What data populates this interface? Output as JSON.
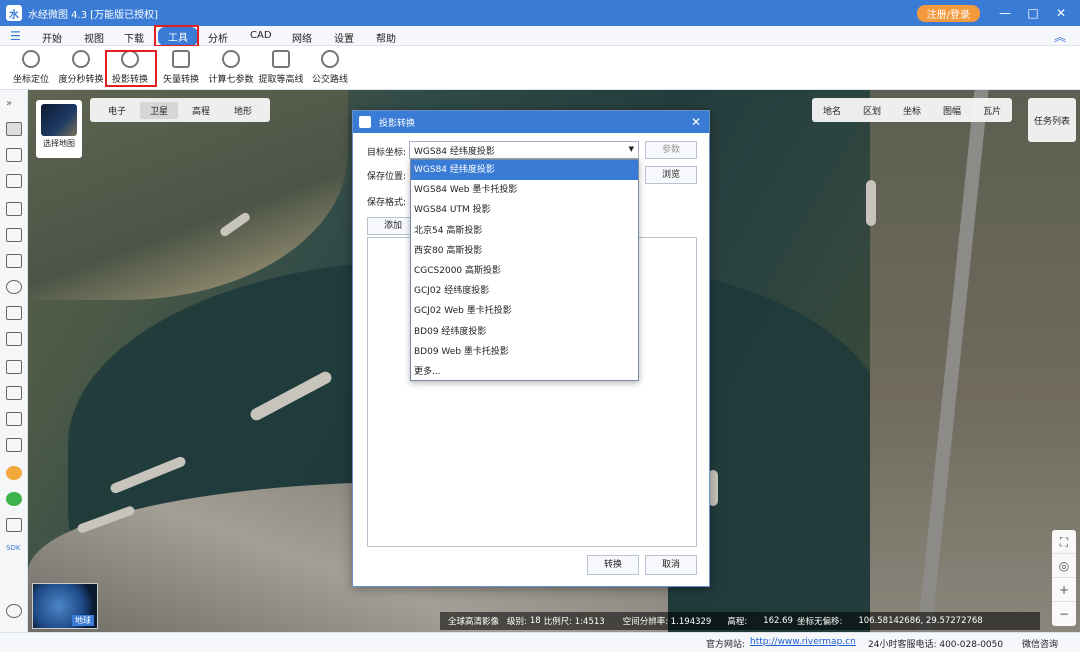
{
  "window": {
    "title": "水经微图 4.3 [万能版已授权]",
    "register_label": "注册/登录",
    "minimize": "—",
    "maximize": "□",
    "close": "✕"
  },
  "menu": {
    "items": [
      "开始",
      "视图",
      "下载",
      "工具",
      "分析",
      "CAD",
      "网络",
      "设置",
      "帮助"
    ],
    "active": "工具",
    "hamburger": "☰",
    "collapse": "︽"
  },
  "toolbar": {
    "items": [
      "坐标定位",
      "度分秒转换",
      "投影转换",
      "矢量转换",
      "计算七参数",
      "提取等高线",
      "公交路线"
    ]
  },
  "map": {
    "tabs": [
      "电子",
      "卫星",
      "高程",
      "地形"
    ],
    "active_tab": "卫星",
    "select_map_label": "选择地图",
    "right_tools": [
      "地名",
      "区划",
      "坐标",
      "图幅",
      "瓦片"
    ],
    "task_list": "任务列表",
    "globe_label": "地球",
    "info": {
      "source": "全球高清影像",
      "level": "级别:",
      "level_value": "18",
      "scale": "比例尺: 1:4513",
      "resolution": "空间分辨率: 1.194329",
      "elevation": "高程:",
      "elevation_value": "162.69",
      "offset": "坐标无偏移:",
      "coords": "106.58142686, 29.57272768"
    },
    "zoom": [
      "⛶",
      "◎",
      "+",
      "−"
    ]
  },
  "status": {
    "website_label": "官方网站:",
    "website": "http://www.rivermap.cn",
    "hotline": "24小时客服电话: 400-028-0050",
    "wechat": "微信咨询"
  },
  "dialog": {
    "title": "投影转换",
    "close": "✕",
    "target_label": "目标坐标:",
    "target_value": "WGS84 经纬度投影",
    "params_button": "参数",
    "save_location_label": "保存位置:",
    "browse_button": "浏览",
    "save_format_label": "保存格式:",
    "add_button": "添加",
    "convert_button": "转换",
    "cancel_button": "取消"
  },
  "dropdown_options": [
    "WGS84 经纬度投影",
    "WGS84 Web 墨卡托投影",
    "WGS84 UTM 投影",
    "北京54 高斯投影",
    "西安80 高斯投影",
    "CGCS2000 高斯投影",
    "GCJ02 经纬度投影",
    "GCJ02 Web 墨卡托投影",
    "BD09 经纬度投影",
    "BD09 Web 墨卡托投影",
    "更多..."
  ],
  "colors": {
    "accent": "#3a7bd5",
    "highlight": "#e02020",
    "register": "#f29a3c"
  }
}
